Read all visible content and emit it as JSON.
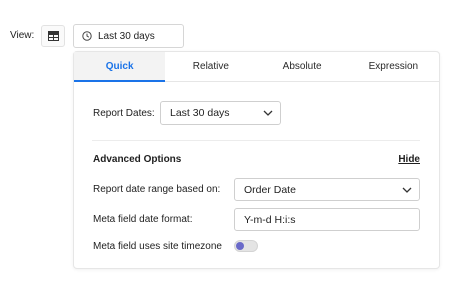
{
  "view": {
    "label": "View:",
    "date_button_label": "Last 30 days"
  },
  "tabs": [
    {
      "label": "Quick",
      "active": true
    },
    {
      "label": "Relative",
      "active": false
    },
    {
      "label": "Absolute",
      "active": false
    },
    {
      "label": "Expression",
      "active": false
    }
  ],
  "report_dates": {
    "label": "Report Dates:",
    "value": "Last 30 days"
  },
  "advanced": {
    "title": "Advanced Options",
    "hide_label": "Hide",
    "range_based_on_label": "Report date range based on:",
    "range_based_on_value": "Order Date",
    "meta_date_format_label": "Meta field date format:",
    "meta_date_format_value": "Y-m-d H:i:s",
    "meta_timezone_label": "Meta field uses site timezone",
    "meta_timezone_enabled": false
  },
  "colors": {
    "accent": "#1a73e8",
    "toggle_knob": "#6a6ac9"
  }
}
